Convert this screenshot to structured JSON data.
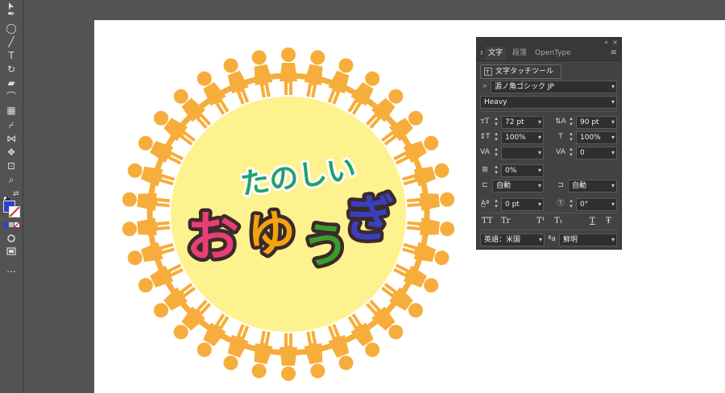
{
  "toolbar": {
    "tools": [
      {
        "name": "pen-tool-icon",
        "glyph": "✒"
      },
      {
        "name": "ellipse-tool-icon",
        "glyph": "◯"
      },
      {
        "name": "paintbrush-tool-icon",
        "glyph": "╱"
      },
      {
        "name": "type-tool-icon",
        "glyph": "T"
      },
      {
        "name": "rotate-tool-icon",
        "glyph": "↻"
      },
      {
        "name": "eraser-tool-icon",
        "glyph": "▰"
      },
      {
        "name": "lasso-tool-icon",
        "glyph": "⌒"
      },
      {
        "name": "gradient-tool-icon",
        "glyph": "▦"
      },
      {
        "name": "eyedropper-tool-icon",
        "glyph": "⌿"
      },
      {
        "name": "blend-tool-icon",
        "glyph": "⋈"
      },
      {
        "name": "symbol-sprayer-tool-icon",
        "glyph": "❖"
      },
      {
        "name": "artboard-tool-icon",
        "glyph": "⊡"
      },
      {
        "name": "zoom-tool-icon",
        "glyph": "⌕"
      }
    ],
    "more_label": "..."
  },
  "artwork": {
    "line1": "たのしい",
    "line2": [
      "お",
      "ゆ",
      "う",
      "ぎ"
    ],
    "colors": {
      "people": "#F7AD3B",
      "circle": "#FDF28E",
      "line1": "#22A06E",
      "o": "#E83E73",
      "yu": "#F5A20E",
      "u": "#3B9E2B",
      "gi": "#3B3FBF"
    }
  },
  "panel": {
    "tabs": [
      "文字",
      "段落",
      "OpenType"
    ],
    "active_tab": "文字",
    "touch_tool": "文字タッチツール",
    "font_family": "源ノ角ゴシック JP",
    "font_style": "Heavy",
    "font_size": "72 pt",
    "leading": "90 pt",
    "vertical_scale": "100%",
    "horizontal_scale": "100%",
    "kerning": "",
    "tracking": "0",
    "tsume": "0%",
    "aki_left": "自動",
    "aki_right": "自動",
    "baseline_shift": "0 pt",
    "rotation": "0°",
    "typo_buttons": [
      "TT",
      "Tr",
      "T¹",
      "T₁",
      "T",
      "Ŧ"
    ],
    "language": "英語：米国",
    "antialias": "鮮明",
    "collapse_label": "«",
    "close_label": "×",
    "menu_label": "≡"
  }
}
